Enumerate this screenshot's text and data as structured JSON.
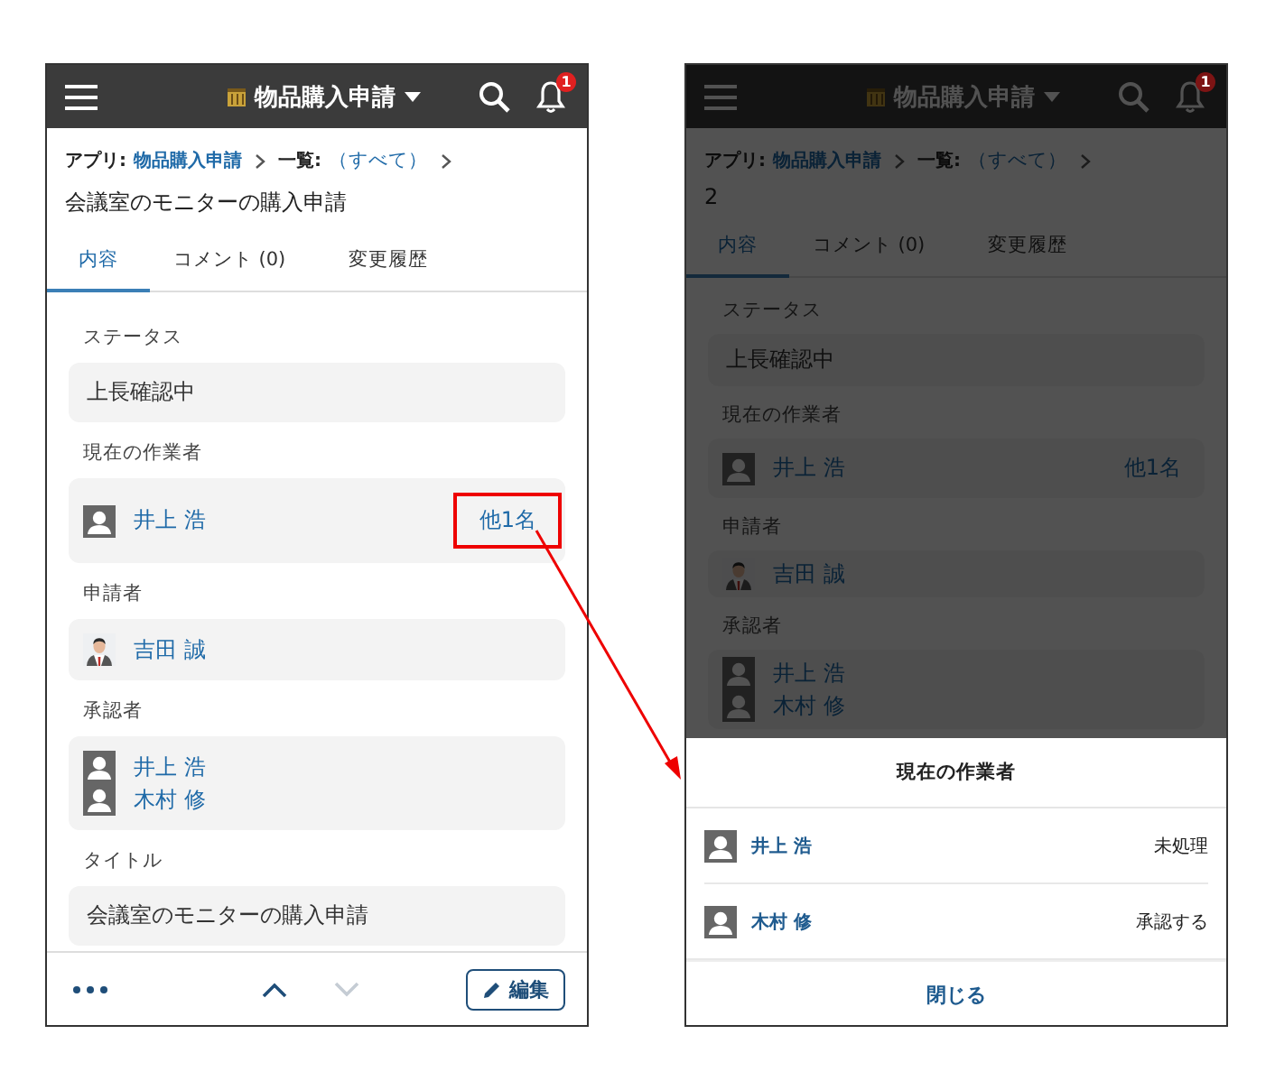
{
  "phones": [
    {
      "header": {
        "app_title": "物品購入申請",
        "badge": "1"
      },
      "breadcrumb": {
        "app_label": "アプリ:",
        "app": "物品購入申請",
        "list_label": "一覧:",
        "view": "（すべて）"
      },
      "record_title": "会議室のモニターの購入申請",
      "tabs": [
        {
          "label": "内容",
          "selected": true
        },
        {
          "label": "コメント (0)",
          "selected": false
        },
        {
          "label": "変更履歴",
          "selected": false
        }
      ],
      "fields": [
        {
          "label": "ステータス",
          "kind": "text",
          "value": "上長確認中"
        },
        {
          "label": "現在の作業者",
          "kind": "users",
          "users": [
            {
              "name": "井上 浩",
              "kind": "generic"
            }
          ],
          "more": "他1名",
          "more_highlighted": true
        },
        {
          "label": "申請者",
          "kind": "users",
          "users": [
            {
              "name": "吉田 誠",
              "kind": "photo"
            }
          ]
        },
        {
          "label": "承認者",
          "kind": "users",
          "users": [
            {
              "name": "井上 浩",
              "kind": "generic"
            },
            {
              "name": "木村 修",
              "kind": "generic"
            }
          ]
        },
        {
          "label": "タイトル",
          "kind": "text",
          "value": "会議室のモニターの購入申請"
        }
      ],
      "toolbar": {
        "nav": [
          {
            "kind": "up",
            "disabled": false
          },
          {
            "kind": "down",
            "disabled": true
          }
        ],
        "edit": "編集"
      },
      "dimmed": false
    },
    {
      "header": {
        "app_title": "物品購入申請",
        "badge": "1"
      },
      "breadcrumb": {
        "app_label": "アプリ:",
        "app": "物品購入申請",
        "list_label": "一覧:",
        "view": "（すべて）"
      },
      "record_title": "2",
      "tabs": [
        {
          "label": "内容",
          "selected": true
        },
        {
          "label": "コメント (0)",
          "selected": false
        },
        {
          "label": "変更履歴",
          "selected": false
        }
      ],
      "fields": [
        {
          "label": "ステータス",
          "kind": "text",
          "value": "上長確認中"
        },
        {
          "label": "現在の作業者",
          "kind": "users",
          "users": [
            {
              "name": "井上 浩",
              "kind": "generic"
            }
          ],
          "more": "他1名",
          "more_highlighted": false
        },
        {
          "label": "申請者",
          "kind": "users",
          "users": [
            {
              "name": "吉田 誠",
              "kind": "photo"
            }
          ]
        },
        {
          "label": "承認者",
          "kind": "users",
          "users": [
            {
              "name": "井上 浩",
              "kind": "generic"
            },
            {
              "name": "木村 修",
              "kind": "generic"
            }
          ]
        }
      ],
      "dimmed": true,
      "sheet": {
        "title": "現在の作業者",
        "rows": [
          {
            "name": "井上 浩",
            "status": "未処理"
          },
          {
            "name": "木村 修",
            "status": "承認する"
          }
        ],
        "close": "閉じる"
      }
    }
  ]
}
